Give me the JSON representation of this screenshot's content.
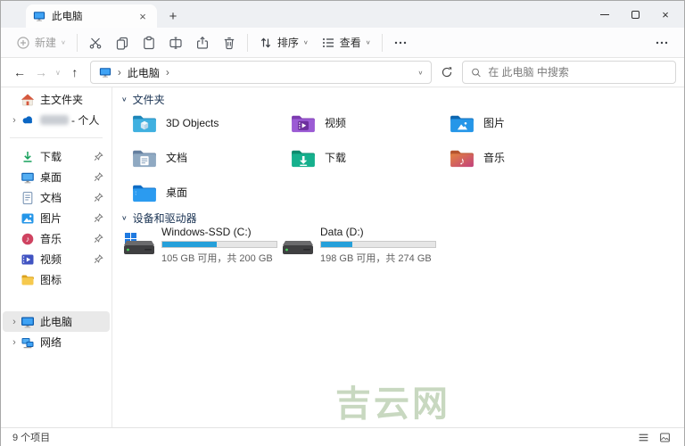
{
  "window": {
    "tab_title": "此电脑"
  },
  "glyphs": {
    "plus": "+",
    "close": "×",
    "minimize_note": "─",
    "back": "←",
    "forward": "→",
    "up": "↑",
    "chevron_down": "∨",
    "chevron_right": "›",
    "ellipsis": "…",
    "music_note": "♪"
  },
  "toolbar": {
    "new_label": "新建",
    "sort_label": "排序",
    "view_label": "查看"
  },
  "address": {
    "breadcrumb": [
      "此电脑"
    ],
    "search_placeholder": "在 此电脑 中搜索"
  },
  "sidebar": {
    "items": [
      {
        "label": "主文件夹",
        "icon": "home-icon",
        "pinned": false,
        "expandable": false
      },
      {
        "label": "- 个人",
        "icon": "onedrive-cloud-icon",
        "redacted_name": true,
        "expandable": true
      },
      {
        "label": "下载",
        "icon": "download-icon",
        "pinned": true
      },
      {
        "label": "桌面",
        "icon": "desktop-icon",
        "pinned": true
      },
      {
        "label": "文档",
        "icon": "document-icon",
        "pinned": true
      },
      {
        "label": "图片",
        "icon": "picture-icon",
        "pinned": true
      },
      {
        "label": "音乐",
        "icon": "music-icon",
        "pinned": true
      },
      {
        "label": "视频",
        "icon": "video-icon",
        "pinned": true
      },
      {
        "label": "图标",
        "icon": "yellow-folder-icon",
        "pinned": false
      },
      {
        "label": "此电脑",
        "icon": "this-pc-icon",
        "selected": true,
        "expandable": true
      },
      {
        "label": "网络",
        "icon": "network-icon",
        "expandable": true
      }
    ]
  },
  "main": {
    "sections": [
      {
        "title": "文件夹"
      },
      {
        "title": "设备和驱动器"
      }
    ],
    "folders": [
      {
        "name": "3D Objects"
      },
      {
        "name": "视频"
      },
      {
        "name": "图片"
      },
      {
        "name": "文档"
      },
      {
        "name": "下载"
      },
      {
        "name": "音乐"
      },
      {
        "name": "桌面"
      }
    ],
    "drives": [
      {
        "name": "Windows-SSD (C:)",
        "info": "105 GB 可用，共 200 GB",
        "used_pct": 47.5
      },
      {
        "name": "Data (D:)",
        "info": "198 GB 可用，共 274 GB",
        "used_pct": 27.7
      }
    ]
  },
  "statusbar": {
    "items_count": "9 个项目"
  },
  "watermark": {
    "text": "吉云网",
    "color": "#c8d8c0"
  },
  "colors": {
    "accent_bar_blue": "#26a0da",
    "titlebar_bg": "#eef0f3",
    "selection_bg": "#e9e9e9",
    "section_header_text": "#1a3353"
  }
}
